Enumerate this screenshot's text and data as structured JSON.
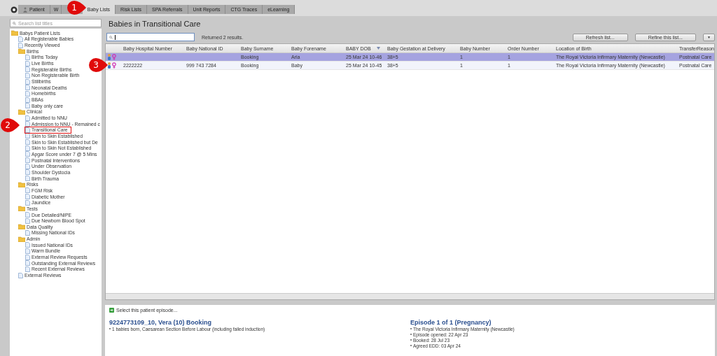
{
  "tabs": [
    {
      "label": "Patient",
      "selected": false
    },
    {
      "label": "W",
      "selected": false
    },
    {
      "label": "Baby Lists",
      "selected": true
    },
    {
      "label": "Risk Lists",
      "selected": false
    },
    {
      "label": "SPA Referrals",
      "selected": false
    },
    {
      "label": "Unit Reports",
      "selected": false
    },
    {
      "label": "CTG Traces",
      "selected": false
    },
    {
      "label": "eLearning",
      "selected": false
    }
  ],
  "sidebar": {
    "search": {
      "placeholder": "Search list titles"
    },
    "tree": [
      {
        "label": "Babys Patient Lists",
        "highlighted": false,
        "children": [
          {
            "label": "All Registerable Babies",
            "highlighted": false
          },
          {
            "label": "Recently Viewed",
            "highlighted": false
          },
          {
            "label": "Births",
            "highlighted": false,
            "children": [
              {
                "label": "Births Today",
                "highlighted": false
              },
              {
                "label": "Live Births",
                "highlighted": false
              },
              {
                "label": "Registerable Births",
                "highlighted": false
              },
              {
                "label": "Non Registerable Birth",
                "highlighted": false
              },
              {
                "label": "Stillbirths",
                "highlighted": false
              },
              {
                "label": "Neonatal Deaths",
                "highlighted": false
              },
              {
                "label": "Homebirths",
                "highlighted": false
              },
              {
                "label": "BBAs",
                "highlighted": false
              },
              {
                "label": "Baby only care",
                "highlighted": false
              }
            ]
          },
          {
            "label": "Clinical",
            "highlighted": false,
            "children": [
              {
                "label": "Admitted to NNU",
                "highlighted": false
              },
              {
                "label": "Admission to NNU - Remained c",
                "highlighted": false
              },
              {
                "label": "Transitional Care",
                "highlighted": true
              },
              {
                "label": "Skin to Skin Established",
                "highlighted": false
              },
              {
                "label": "Skin to Skin Established but De",
                "highlighted": false
              },
              {
                "label": "Skin to Skin Not Established",
                "highlighted": false
              },
              {
                "label": "Apgar Score under 7 @ 5 Mins",
                "highlighted": false
              },
              {
                "label": "Postnatal Interventions",
                "highlighted": false
              },
              {
                "label": "Under Observation",
                "highlighted": false
              },
              {
                "label": "Shoulder Dystocia",
                "highlighted": false
              },
              {
                "label": "Birth Trauma",
                "highlighted": false
              }
            ]
          },
          {
            "label": "Risks",
            "highlighted": false,
            "children": [
              {
                "label": "FGM Risk",
                "highlighted": false
              },
              {
                "label": "Diabetic Mother",
                "highlighted": false
              },
              {
                "label": "Jaundice",
                "highlighted": false
              }
            ]
          },
          {
            "label": "Tests",
            "highlighted": false,
            "children": [
              {
                "label": "Due Detailed/NIPE",
                "highlighted": false
              },
              {
                "label": "Due Newborn Blood Spot",
                "highlighted": false
              }
            ]
          },
          {
            "label": "Data Quality",
            "highlighted": false,
            "children": [
              {
                "label": "Missing National IDs",
                "highlighted": false
              }
            ]
          },
          {
            "label": "Admin",
            "highlighted": false,
            "children": [
              {
                "label": "Issued National IDs",
                "highlighted": false
              },
              {
                "label": "Warm Bundle",
                "highlighted": false
              },
              {
                "label": "External Review Requests",
                "highlighted": false
              },
              {
                "label": "Outstanding External Reviews",
                "highlighted": false
              },
              {
                "label": "Recent External Reviews",
                "highlighted": false
              }
            ]
          },
          {
            "label": "External Reviews",
            "highlighted": false
          }
        ]
      }
    ]
  },
  "title": "Babies in Transitional Care",
  "search": {
    "result": "Returned 2 results."
  },
  "buttons": [
    "Refresh list...",
    "Refine this list...",
    "▼"
  ],
  "table": {
    "columns": [
      "Baby Hospital Number",
      "Baby National ID",
      "Baby Surname",
      "Baby Forename",
      "BABY DOB",
      "Baby Gestation at Delivery",
      "Baby Number",
      "Order Number",
      "Location of Birth",
      "TransferReason"
    ],
    "rows": [
      {
        "selected": true,
        "cells": [
          "",
          "",
          "Booking",
          "Aria",
          "25 Mar 24 10-46",
          "38+5",
          "1",
          "1",
          "The Royal Victoria Infirmary Maternity (Newcastle)",
          "Postnatal Care"
        ]
      },
      {
        "selected": false,
        "cells": [
          "2222222",
          "999 743 7284",
          "Booking",
          "Baby",
          "25 Mar 24 10-45",
          "38+5",
          "1",
          "1",
          "The Royal Victoria Infirmary Maternity (Newcastle)",
          "Postnatal Care"
        ]
      }
    ]
  },
  "details": {
    "select_link": "Select this patient episode...",
    "patient": {
      "title": "9224773109_10, Vera (10) Booking",
      "lines": [
        "1 babies born, Caesarean Section Before Labour (including failed induction)"
      ]
    },
    "episode": {
      "title": "Episode 1 of 1 (Pregnancy)",
      "lines": [
        "The Royal Victoria Infirmary Maternity (Newcastle)",
        "Episode opened: 22 Apr 23",
        "Booked: 28 Jul 23",
        "Agreed EDD: 03 Apr 24"
      ]
    }
  },
  "annotations": [
    {
      "number": "1"
    },
    {
      "number": "2"
    },
    {
      "number": "3"
    }
  ]
}
